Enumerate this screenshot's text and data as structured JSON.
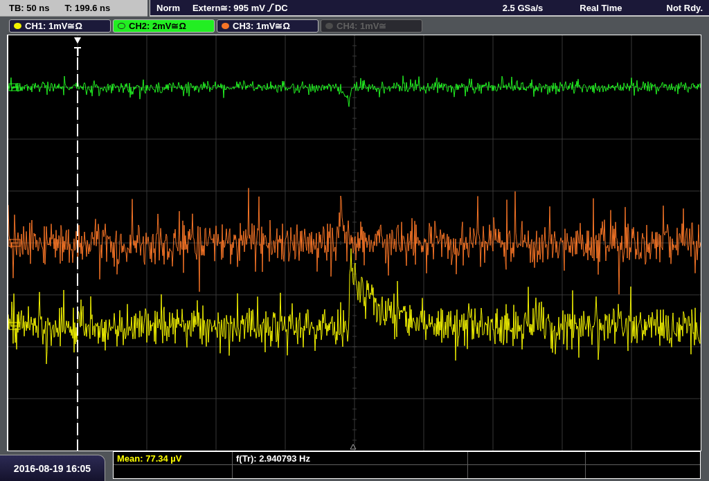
{
  "status_left": [
    "TB: 50 ns",
    "T: 199.6 ns"
  ],
  "trigger": {
    "mode": "Norm",
    "source": "Extern≅: 995 mV",
    "slope_rising": true,
    "coupling": "DC"
  },
  "acquisition": {
    "sample_rate": "2.5 GSa/s",
    "mode": "Real Time",
    "status": "Not Rdy."
  },
  "channels": [
    {
      "label": "CH1: 1mV≅Ω",
      "color": "#f2f200",
      "selected": false,
      "enabled": true
    },
    {
      "label": "CH2: 2mV≅Ω",
      "color": "#22ee22",
      "selected": true,
      "enabled": true
    },
    {
      "label": "CH3: 1mV≅Ω",
      "color": "#f57426",
      "selected": false,
      "enabled": true
    },
    {
      "label": "CH4: 1mV≅",
      "color": "#4c4c4c",
      "selected": false,
      "enabled": false
    }
  ],
  "date_time": "2016-08-19 16:05",
  "measurements": [
    {
      "label": "Mean: 77.34 µV",
      "kind": "channel"
    },
    {
      "label": "f(Tr): 2.940793 Hz",
      "kind": "trigger"
    }
  ]
}
